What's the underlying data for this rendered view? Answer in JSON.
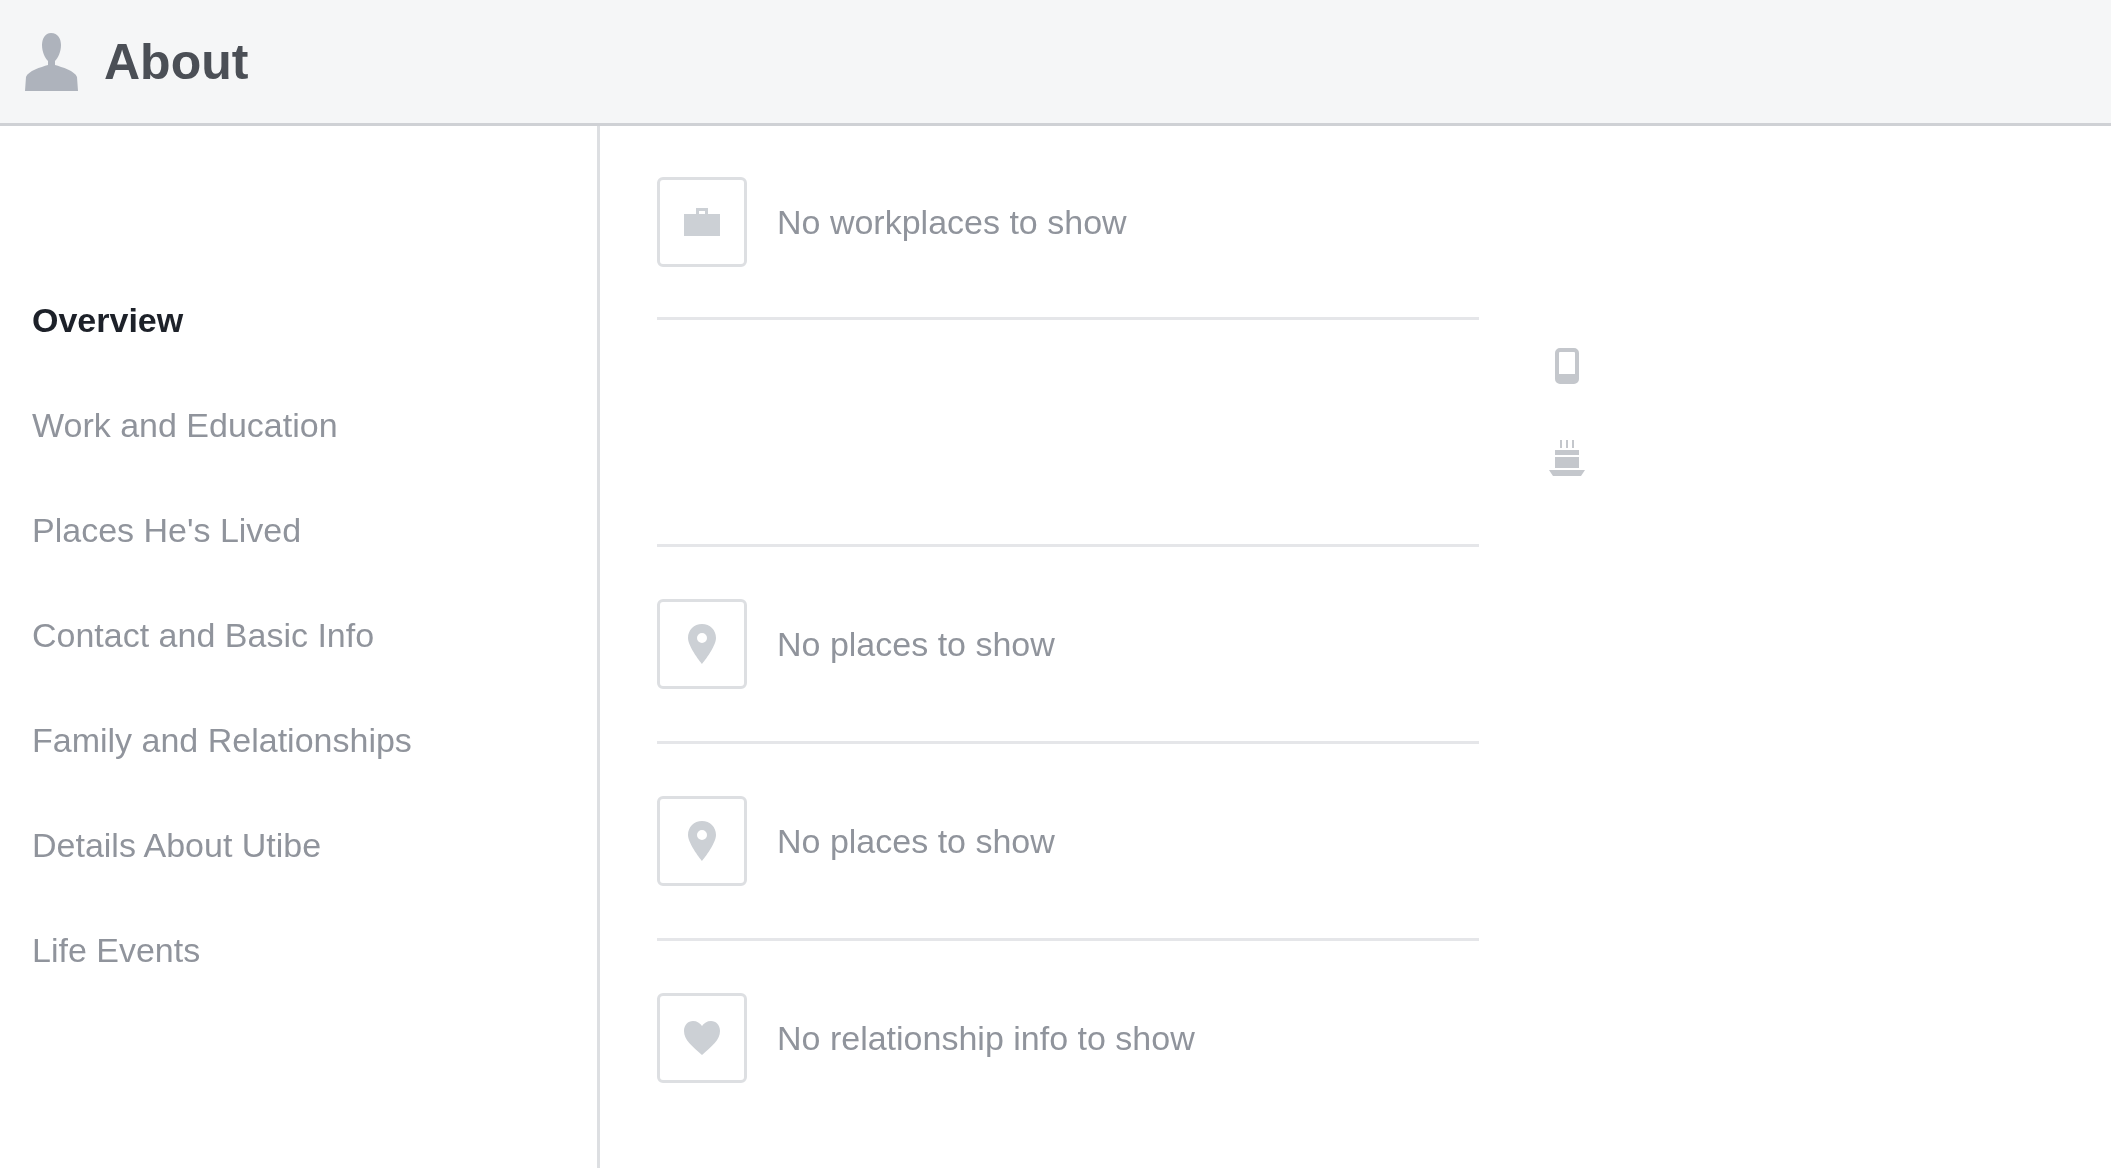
{
  "header": {
    "title": "About"
  },
  "sidebar": {
    "items": [
      {
        "label": "Overview",
        "selected": true
      },
      {
        "label": "Work and Education",
        "selected": false
      },
      {
        "label": "Places He's Lived",
        "selected": false
      },
      {
        "label": "Contact and Basic Info",
        "selected": false
      },
      {
        "label": "Family and Relationships",
        "selected": false
      },
      {
        "label": "Details About Utibe",
        "selected": false
      },
      {
        "label": "Life Events",
        "selected": false
      }
    ]
  },
  "sections": [
    {
      "kind": "workplace",
      "text": "No workplaces to show"
    },
    {
      "kind": "blank"
    },
    {
      "kind": "place",
      "text": "No places to show"
    },
    {
      "kind": "place",
      "text": "No places to show"
    },
    {
      "kind": "relationship",
      "text": "No relationship info to show"
    }
  ]
}
